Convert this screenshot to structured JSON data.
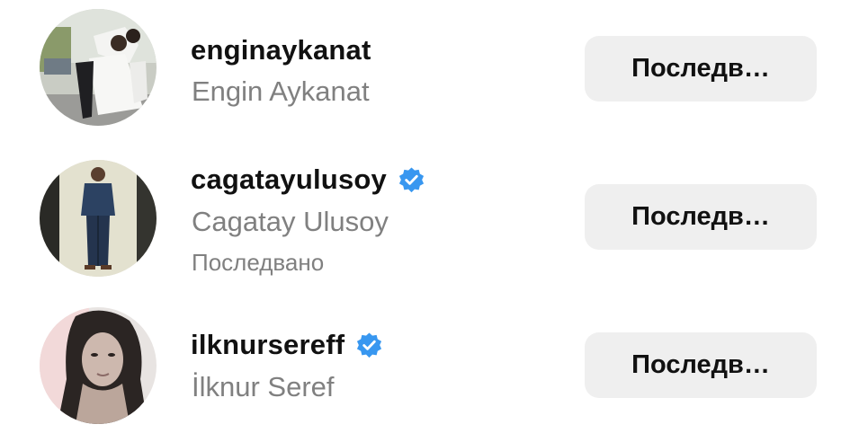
{
  "accounts": [
    {
      "username": "enginaykanat",
      "full_name": "Engin Aykanat",
      "verified": false,
      "status": "",
      "button_label": "Последв…",
      "avatar_icon": "couple-photo-avatar"
    },
    {
      "username": "cagatayulusoy",
      "full_name": "Cagatay Ulusoy",
      "verified": true,
      "status": "Последвано",
      "button_label": "Последв…",
      "avatar_icon": "man-standing-photo-avatar"
    },
    {
      "username": "ilknursereff",
      "full_name": "İlknur Seref",
      "verified": true,
      "status": "",
      "button_label": "Последв…",
      "avatar_icon": "woman-portrait-photo-avatar"
    }
  ],
  "colors": {
    "verified_badge": "#3897f0",
    "button_bg": "#efefef",
    "secondary_text": "#808080",
    "primary_text": "#111111"
  }
}
